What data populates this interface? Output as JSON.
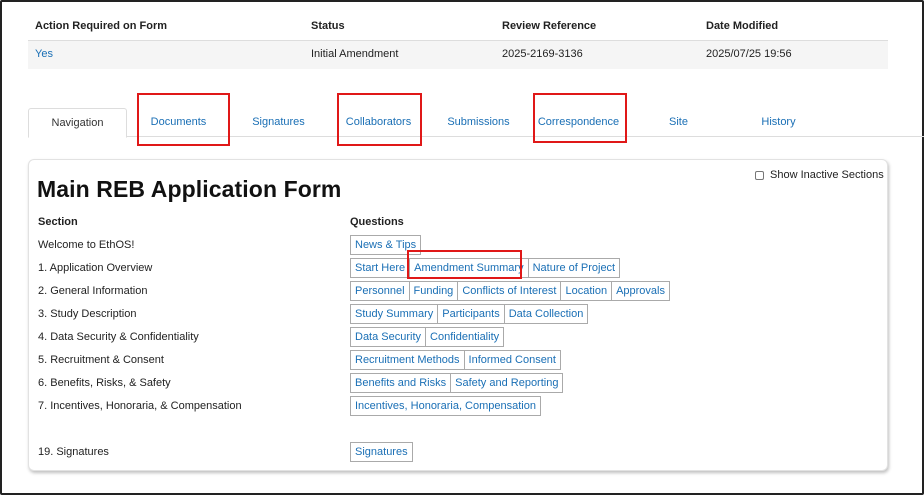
{
  "summary": {
    "headers": [
      "Action Required on Form",
      "Status",
      "Review Reference",
      "Date Modified"
    ],
    "values": [
      "Yes",
      "Initial Amendment",
      "2025-2169-3136",
      "2025/07/25 19:56"
    ]
  },
  "tabs": [
    {
      "label": "Navigation"
    },
    {
      "label": "Documents"
    },
    {
      "label": "Signatures"
    },
    {
      "label": "Collaborators"
    },
    {
      "label": "Submissions"
    },
    {
      "label": "Correspondence"
    },
    {
      "label": "Site"
    },
    {
      "label": "History"
    }
  ],
  "panel": {
    "title": "Main REB Application Form",
    "show_inactive_label": "Show Inactive Sections",
    "section_header": "Section",
    "questions_header": "Questions",
    "rows": [
      {
        "section": "Welcome to EthOS!",
        "questions": [
          "News & Tips"
        ]
      },
      {
        "section": "1. Application Overview",
        "questions": [
          "Start Here",
          "Amendment Summary",
          "Nature of Project"
        ]
      },
      {
        "section": "2. General Information",
        "questions": [
          "Personnel",
          "Funding",
          "Conflicts of Interest",
          "Location",
          "Approvals"
        ]
      },
      {
        "section": "3. Study Description",
        "questions": [
          "Study Summary",
          "Participants",
          "Data Collection"
        ]
      },
      {
        "section": "4. Data Security & Confidentiality",
        "questions": [
          "Data Security",
          "Confidentiality"
        ]
      },
      {
        "section": "5. Recruitment & Consent",
        "questions": [
          "Recruitment Methods",
          "Informed Consent"
        ]
      },
      {
        "section": "6. Benefits, Risks, & Safety",
        "questions": [
          "Benefits and Risks",
          "Safety and Reporting"
        ]
      },
      {
        "section": "7. Incentives, Honoraria, & Compensation",
        "questions": [
          "Incentives, Honoraria, Compensation"
        ]
      },
      {
        "section": "19. Signatures",
        "questions": [
          "Signatures"
        ]
      }
    ]
  },
  "colors": {
    "link": "#1a6fb5",
    "highlight": "#e01818"
  }
}
